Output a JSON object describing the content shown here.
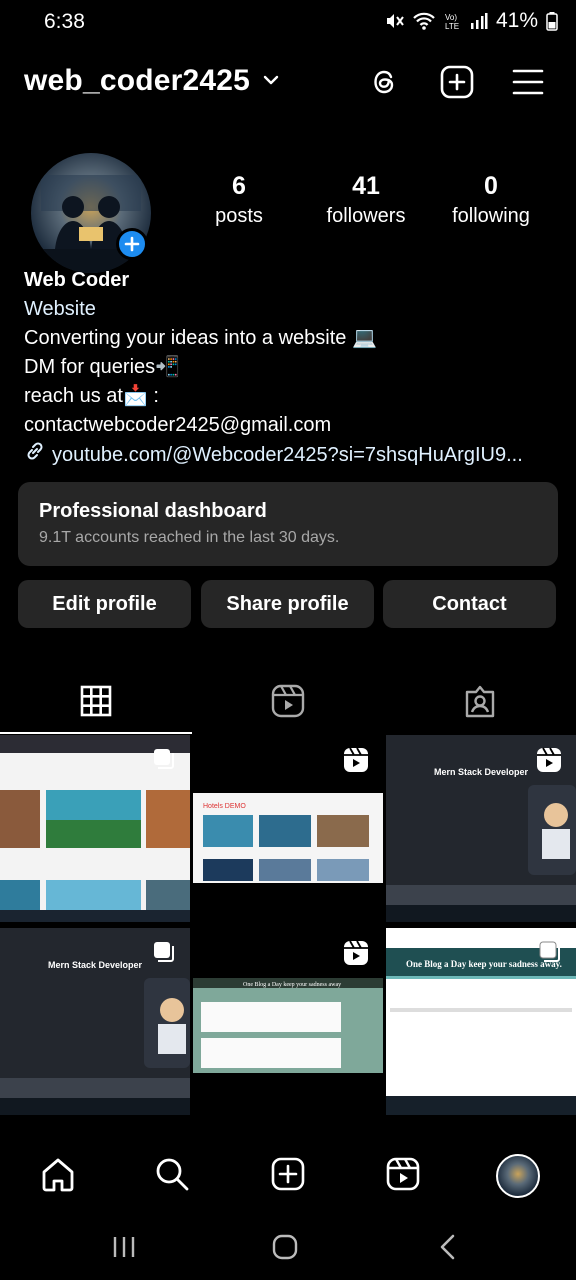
{
  "status_bar": {
    "time": "6:38",
    "battery_percent": "41%",
    "icons": [
      "mute-icon",
      "wifi-icon",
      "volte-icon",
      "signal-icon",
      "battery-icon"
    ]
  },
  "header": {
    "username": "web_coder2425",
    "icons": [
      "chevron-down-icon",
      "threads-icon",
      "create-icon",
      "menu-icon"
    ]
  },
  "profile": {
    "stats": [
      {
        "value": "6",
        "label": "posts"
      },
      {
        "value": "41",
        "label": "followers"
      },
      {
        "value": "0",
        "label": "following"
      }
    ],
    "name": "Web Coder",
    "category": "Website",
    "bio_lines": [
      "Converting your ideas into a website 💻",
      "DM for queries📲",
      "reach us at📩 :",
      "contactwebcoder2425@gmail.com"
    ],
    "link": "youtube.com/@Webcoder2425?si=7shsqHuArgIU9..."
  },
  "dashboard": {
    "title": "Professional dashboard",
    "subtitle": "9.1T accounts reached in the last 30 days."
  },
  "actions": {
    "edit": "Edit profile",
    "share": "Share profile",
    "contact": "Contact"
  },
  "tabs": [
    "grid-icon",
    "reels-icon",
    "tagged-icon"
  ],
  "grid": {
    "tiles": [
      {
        "type": "carousel",
        "heading": ""
      },
      {
        "type": "reel",
        "heading": "Hotels DEMO"
      },
      {
        "type": "reel",
        "heading": "Mern Stack Developer"
      },
      {
        "type": "carousel",
        "heading": "Mern Stack Developer"
      },
      {
        "type": "reel",
        "heading": "One Blog a Day keep your sadness away"
      },
      {
        "type": "carousel",
        "heading": "One Blog a Day keep your sadness away."
      }
    ]
  },
  "bottom_nav": [
    "home-icon",
    "search-icon",
    "create-icon",
    "reels-icon",
    "profile-avatar"
  ],
  "colors": {
    "background": "#000000",
    "surface": "#262626",
    "accent": "#1d8cf0",
    "link": "#e0f1ff",
    "muted": "#a8a8a8"
  }
}
